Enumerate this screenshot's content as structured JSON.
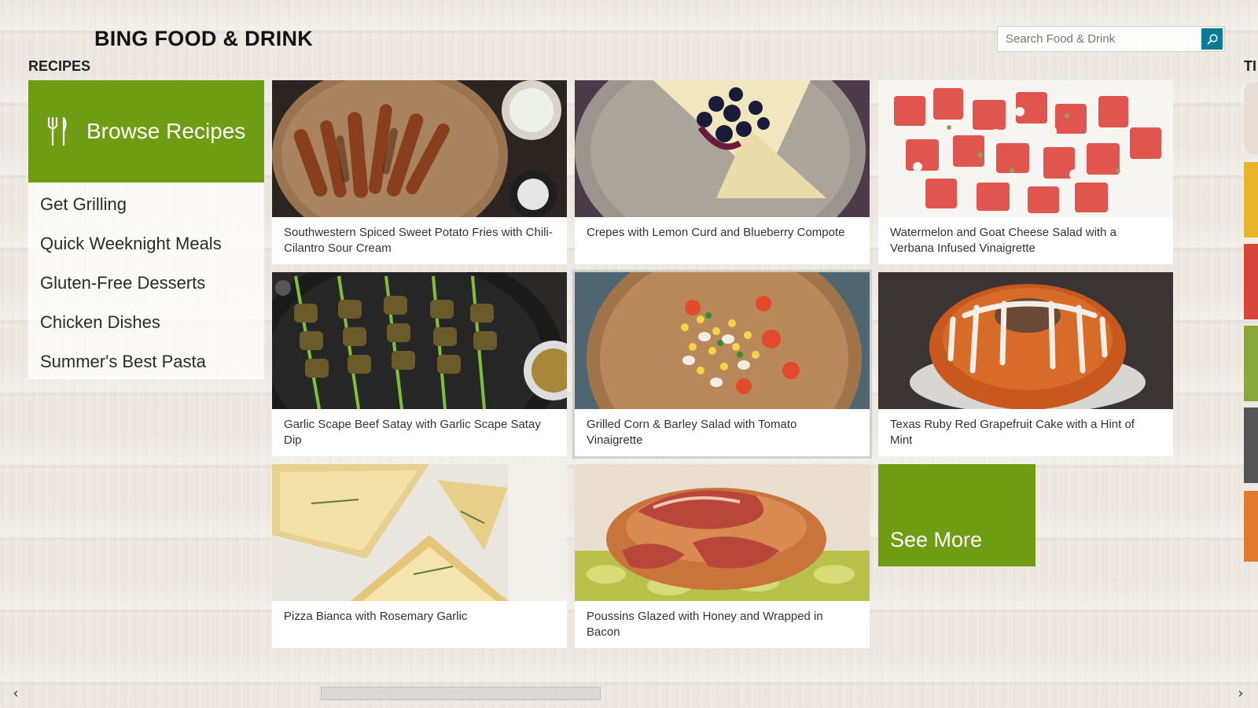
{
  "header": {
    "app_title": "BING FOOD & DRINK",
    "search_placeholder": "Search Food & Drink"
  },
  "sections": {
    "recipes_title": "RECIPES",
    "next_section_peek": "TI"
  },
  "browse": {
    "label": "Browse Recipes",
    "icon": "fork-knife-icon"
  },
  "categories": [
    {
      "label": "Get Grilling"
    },
    {
      "label": "Quick Weeknight Meals"
    },
    {
      "label": "Gluten-Free Desserts"
    },
    {
      "label": "Chicken Dishes"
    },
    {
      "label": "Summer's Best Pasta"
    }
  ],
  "recipes": [
    {
      "title": "Southwestern Spiced Sweet Potato Fries with Chili-Cilantro Sour Cream"
    },
    {
      "title": "Crepes with Lemon Curd and Blueberry Compote"
    },
    {
      "title": "Watermelon and Goat Cheese Salad with a Verbana Infused Vinaigrette"
    },
    {
      "title": "Garlic Scape Beef Satay with Garlic Scape Satay Dip"
    },
    {
      "title": "Grilled Corn & Barley Salad with Tomato Vinaigrette"
    },
    {
      "title": "Texas Ruby Red Grapefruit Cake with a Hint of Mint"
    },
    {
      "title": "Pizza Bianca with Rosemary Garlic"
    },
    {
      "title": "Poussins Glazed with Honey and Wrapped in Bacon"
    }
  ],
  "see_more": {
    "label": "See More"
  },
  "colors": {
    "tile_green": "#6e9c12",
    "search_button": "#0b7a93",
    "peek_orange": "#e07a2e"
  }
}
